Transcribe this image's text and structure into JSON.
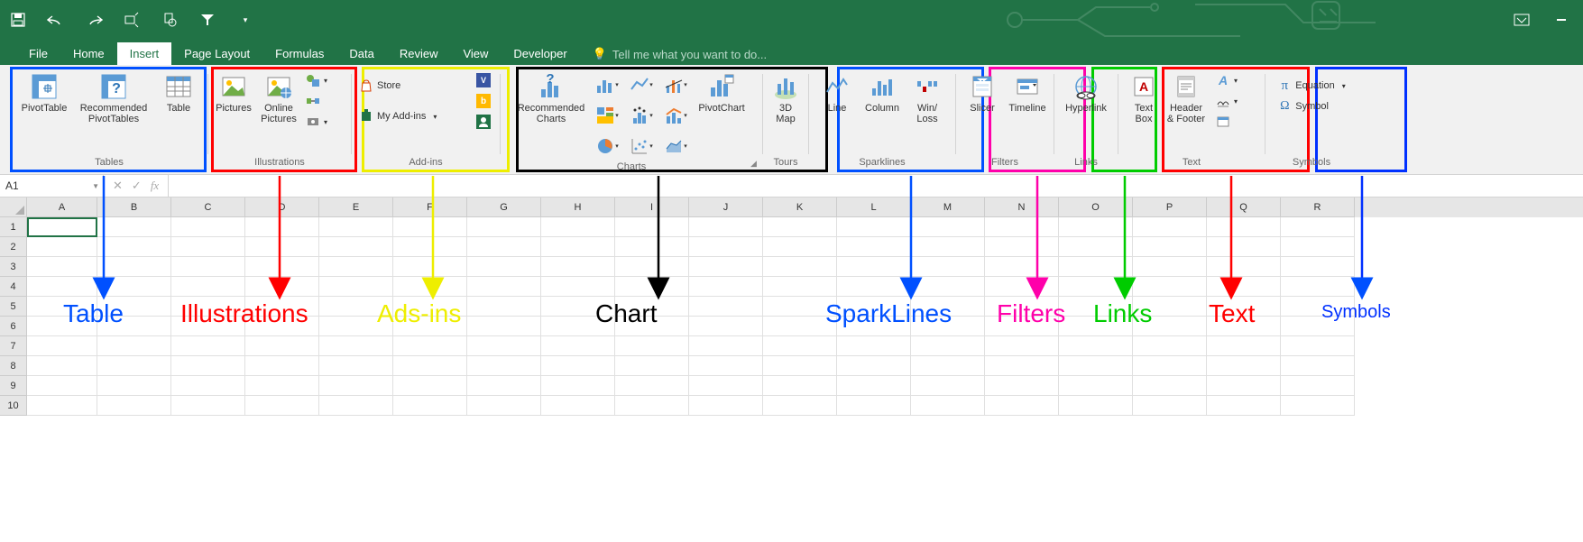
{
  "qat": {
    "save": "save",
    "undo": "undo",
    "redo": "redo",
    "touch": "touch-mode",
    "preview": "print-preview",
    "filter": "filter",
    "more": "more"
  },
  "titlebar": {
    "restore": "restore",
    "minimize": "minimize"
  },
  "tabs": [
    "File",
    "Home",
    "Insert",
    "Page Layout",
    "Formulas",
    "Data",
    "Review",
    "View",
    "Developer"
  ],
  "active_tab": "Insert",
  "tellme": "Tell me what you want to do...",
  "ribbon": {
    "tables": {
      "label": "Tables",
      "pivottable": "PivotTable",
      "recommended": "Recommended\nPivotTables",
      "table": "Table"
    },
    "illustrations": {
      "label": "Illustrations",
      "pictures": "Pictures",
      "online": "Online\nPictures",
      "shapes": "Shapes",
      "smartart": "SmartArt",
      "screenshot": "Screenshot"
    },
    "addins": {
      "label": "Add-ins",
      "store": "Store",
      "myaddins": "My Add-ins",
      "bing": "Bing",
      "people": "People"
    },
    "charts": {
      "label": "Charts",
      "recommended": "Recommended\nCharts",
      "pivotchart": "PivotChart"
    },
    "tours": {
      "label": "Tours",
      "map": "3D\nMap"
    },
    "sparklines": {
      "label": "Sparklines",
      "line": "Line",
      "column": "Column",
      "winloss": "Win/\nLoss"
    },
    "filters": {
      "label": "Filters",
      "slicer": "Slicer",
      "timeline": "Timeline"
    },
    "links": {
      "label": "Links",
      "hyperlink": "Hyperlink"
    },
    "text": {
      "label": "Text",
      "textbox": "Text\nBox",
      "header": "Header\n& Footer",
      "wordart": "WordArt",
      "sig": "Signature",
      "obj": "Object"
    },
    "symbols": {
      "label": "Symbols",
      "equation": "Equation",
      "symbol": "Symbol"
    }
  },
  "namebox": "A1",
  "columns": [
    "A",
    "B",
    "C",
    "D",
    "E",
    "F",
    "G",
    "H",
    "I",
    "J",
    "K",
    "L",
    "M",
    "N",
    "O",
    "P",
    "Q",
    "R"
  ],
  "rows": [
    1,
    2,
    3,
    4,
    5,
    6,
    7,
    8,
    9,
    10
  ],
  "annotations": {
    "table": "Table",
    "illustrations": "Illustrations",
    "addins": "Ads-ins",
    "chart": "Chart",
    "sparklines": "SparkLines",
    "filters": "Filters",
    "links": "Links",
    "text": "Text",
    "symbols": "Symbols"
  },
  "highlight_colors": {
    "tables": "#0050ff",
    "illustrations": "#ff0000",
    "addins": "#eeee00",
    "charts": "#000000",
    "sparklines": "#0050ff",
    "filters": "#ff00aa",
    "links": "#00cc00",
    "text": "#ff0000",
    "symbols": "#0030ff"
  }
}
